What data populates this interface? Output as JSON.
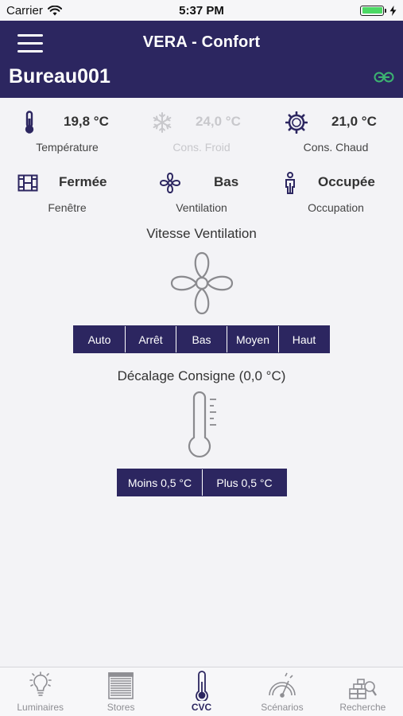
{
  "status_bar": {
    "carrier": "Carrier",
    "time": "5:37 PM",
    "battery_level": 1.0
  },
  "header": {
    "app_title": "VERA - Confort",
    "room_title": "Bureau001"
  },
  "info": [
    {
      "value": "19,8 °C",
      "label": "Température",
      "icon": "thermometer-icon",
      "enabled": true
    },
    {
      "value": "24,0 °C",
      "label": "Cons. Froid",
      "icon": "snowflake-icon",
      "enabled": false
    },
    {
      "value": "21,0 °C",
      "label": "Cons. Chaud",
      "icon": "sun-gear-icon",
      "enabled": true
    },
    {
      "value": "Fermée",
      "label": "Fenêtre",
      "icon": "window-icon",
      "enabled": true
    },
    {
      "value": "Bas",
      "label": "Ventilation",
      "icon": "fan-icon",
      "enabled": true
    },
    {
      "value": "Occupée",
      "label": "Occupation",
      "icon": "person-icon",
      "enabled": true
    }
  ],
  "ventilation": {
    "title": "Vitesse Ventilation",
    "buttons": [
      "Auto",
      "Arrêt",
      "Bas",
      "Moyen",
      "Haut"
    ]
  },
  "offset": {
    "title": "Décalage Consigne (0,0 °C)",
    "buttons": [
      "Moins 0,5 °C",
      "Plus 0,5 °C"
    ]
  },
  "tabs": [
    {
      "label": "Luminaires",
      "icon": "bulb-icon",
      "active": false
    },
    {
      "label": "Stores",
      "icon": "blinds-icon",
      "active": false
    },
    {
      "label": "CVC",
      "icon": "thermometer-icon",
      "active": true
    },
    {
      "label": "Scénarios",
      "icon": "gauge-icon",
      "active": false
    },
    {
      "label": "Recherche",
      "icon": "search-bricks-icon",
      "active": false
    }
  ],
  "colors": {
    "primary": "#2c2660",
    "link_accent": "#3cb371",
    "disabled": "#c8c8cc",
    "battery": "#4cd964"
  }
}
